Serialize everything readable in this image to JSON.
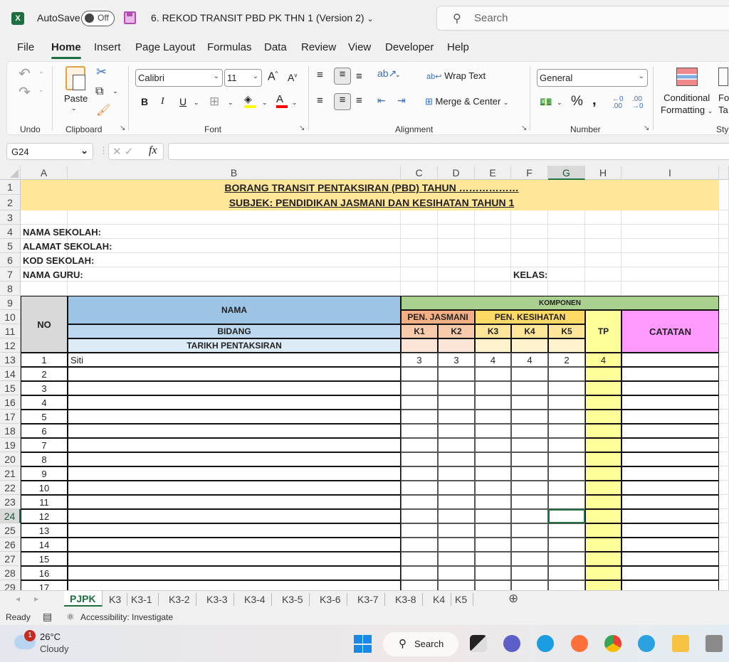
{
  "titlebar": {
    "autosave_label": "AutoSave",
    "autosave_state": "Off",
    "document_name": "6. REKOD TRANSIT PBD PK THN 1 (Version 2)",
    "search_placeholder": "Search"
  },
  "menu": [
    "File",
    "Home",
    "Insert",
    "Page Layout",
    "Formulas",
    "Data",
    "Review",
    "View",
    "Developer",
    "Help"
  ],
  "ribbon": {
    "groups": {
      "undo": "Undo",
      "clipboard": "Clipboard",
      "font": "Font",
      "alignment": "Alignment",
      "number": "Number",
      "styles": "Styl"
    },
    "paste_label": "Paste",
    "font_name": "Calibri",
    "font_size": "11",
    "wrap_text": "Wrap Text",
    "merge_center": "Merge & Center",
    "number_format": "General",
    "conditional_formatting_1": "Conditional",
    "conditional_formatting_2": "Formatting",
    "format_table_1": "Fo",
    "format_table_2": "Ta",
    "colors": {
      "fill": "#ffff00",
      "font": "#ff0000"
    }
  },
  "formula_bar": {
    "name_box": "G24",
    "formula": ""
  },
  "columns": [
    "A",
    "B",
    "C",
    "D",
    "E",
    "F",
    "G",
    "H",
    "I"
  ],
  "selected_cell": {
    "col": "G",
    "row": 24
  },
  "sheet": {
    "title1": "BORANG TRANSIT PENTAKSIRAN (PBD) TAHUN ………………",
    "title2": "SUBJEK: PENDIDIKAN JASMANI DAN KESIHATAN TAHUN 1",
    "nama_sekolah": "NAMA SEKOLAH:",
    "alamat_sekolah": "ALAMAT SEKOLAH:",
    "kod_sekolah": "KOD SEKOLAH:",
    "nama_guru": "NAMA GURU:",
    "kelas": "KELAS:",
    "headers": {
      "no": "NO",
      "nama": "NAMA",
      "bidang": "BIDANG",
      "tarikh": "TARIKH PENTAKSIRAN",
      "komponen": "KOMPONEN",
      "pen_jasmani": "PEN. JASMANI",
      "pen_kesihatan": "PEN. KESIHATAN",
      "k1": "K1",
      "k2": "K2",
      "k3": "K3",
      "k4": "K4",
      "k5": "K5",
      "tp": "TP",
      "catatan": "CATATAN"
    },
    "students": [
      {
        "no": "1",
        "nama": "Siti",
        "k1": "3",
        "k2": "3",
        "k3": "4",
        "k4": "4",
        "k5": "2",
        "tp": "4"
      },
      {
        "no": "2"
      },
      {
        "no": "3"
      },
      {
        "no": "4"
      },
      {
        "no": "5"
      },
      {
        "no": "6"
      },
      {
        "no": "7"
      },
      {
        "no": "8"
      },
      {
        "no": "9"
      },
      {
        "no": "10"
      },
      {
        "no": "11"
      },
      {
        "no": "12"
      },
      {
        "no": "13"
      },
      {
        "no": "14"
      },
      {
        "no": "15"
      },
      {
        "no": "16"
      },
      {
        "no": "17"
      }
    ],
    "colors": {
      "title_bg": "#ffe699",
      "nama_bg": "#9dc3e6",
      "bidang_bg": "#bdd7ee",
      "tarikh_bg": "#ddebf7",
      "no_bg": "#d9d9d9",
      "komponen_bg": "#a9d08e",
      "jasmani_bg": "#f4b084",
      "jasmani_k_bg": "#f8cbad",
      "jasmani_date_bg": "#fce4d6",
      "kesihatan_bg": "#ffd966",
      "kesihatan_k_bg": "#ffe699",
      "kesihatan_date_bg": "#fff2cc",
      "tp_bg": "#ffff99",
      "catatan_bg": "#ff99ff"
    }
  },
  "sheet_tabs": [
    "PJPK",
    "K3",
    "K3-1",
    "K3-2",
    "K3-3",
    "K3-4",
    "K3-5",
    "K3-6",
    "K3-7",
    "K3-8",
    "K4",
    "K5"
  ],
  "active_tab": "PJPK",
  "status": {
    "ready": "Ready",
    "accessibility": "Accessibility: Investigate"
  },
  "taskbar": {
    "weather_temp": "26°C",
    "weather_desc": "Cloudy",
    "weather_badge": "1",
    "search_label": "Search"
  }
}
